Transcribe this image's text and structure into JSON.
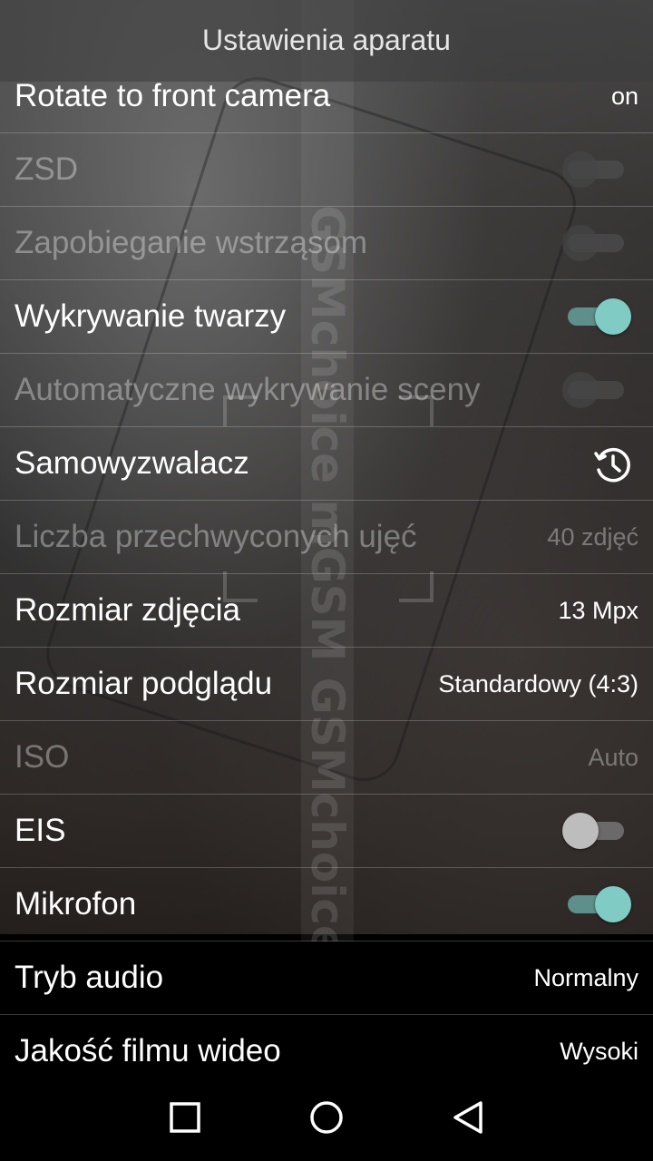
{
  "header": {
    "title": "Ustawienia aparatu"
  },
  "watermark": {
    "text": "GSMchoice mGSM GSMchoice"
  },
  "settings": [
    {
      "label": "Rotate to front camera",
      "value": "on"
    },
    {
      "label": "ZSD",
      "toggle": "off",
      "disabled": true
    },
    {
      "label": "Zapobieganie wstrząsom",
      "toggle": "off",
      "disabled": true
    },
    {
      "label": "Wykrywanie twarzy",
      "toggle": "on"
    },
    {
      "label": "Automatyczne wykrywanie sceny",
      "toggle": "off",
      "disabled": true
    },
    {
      "label": "Samowyzwalacz",
      "icon": "timer-icon"
    },
    {
      "label": "Liczba przechwyconych ujęć",
      "value": "40 zdjęć",
      "disabled": true
    },
    {
      "label": "Rozmiar zdjęcia",
      "value": "13 Mpx"
    },
    {
      "label": "Rozmiar podglądu",
      "value": "Standardowy (4:3)"
    },
    {
      "label": "ISO",
      "value": "Auto",
      "disabled": true
    },
    {
      "label": "EIS",
      "toggle": "off"
    },
    {
      "label": "Mikrofon",
      "toggle": "on"
    },
    {
      "label": "Tryb audio",
      "value": "Normalny"
    },
    {
      "label": "Jakość filmu wideo",
      "value": "Wysoki"
    }
  ],
  "navbar": {
    "icons": [
      "recents-icon",
      "home-icon",
      "back-icon"
    ]
  },
  "colors": {
    "toggle_on_thumb": "#80cbc4",
    "toggle_on_track": "#5e8f8a",
    "toggle_off_thumb": "#bdbdbd",
    "disabled_text": "rgba(255,255,255,0.35)"
  }
}
